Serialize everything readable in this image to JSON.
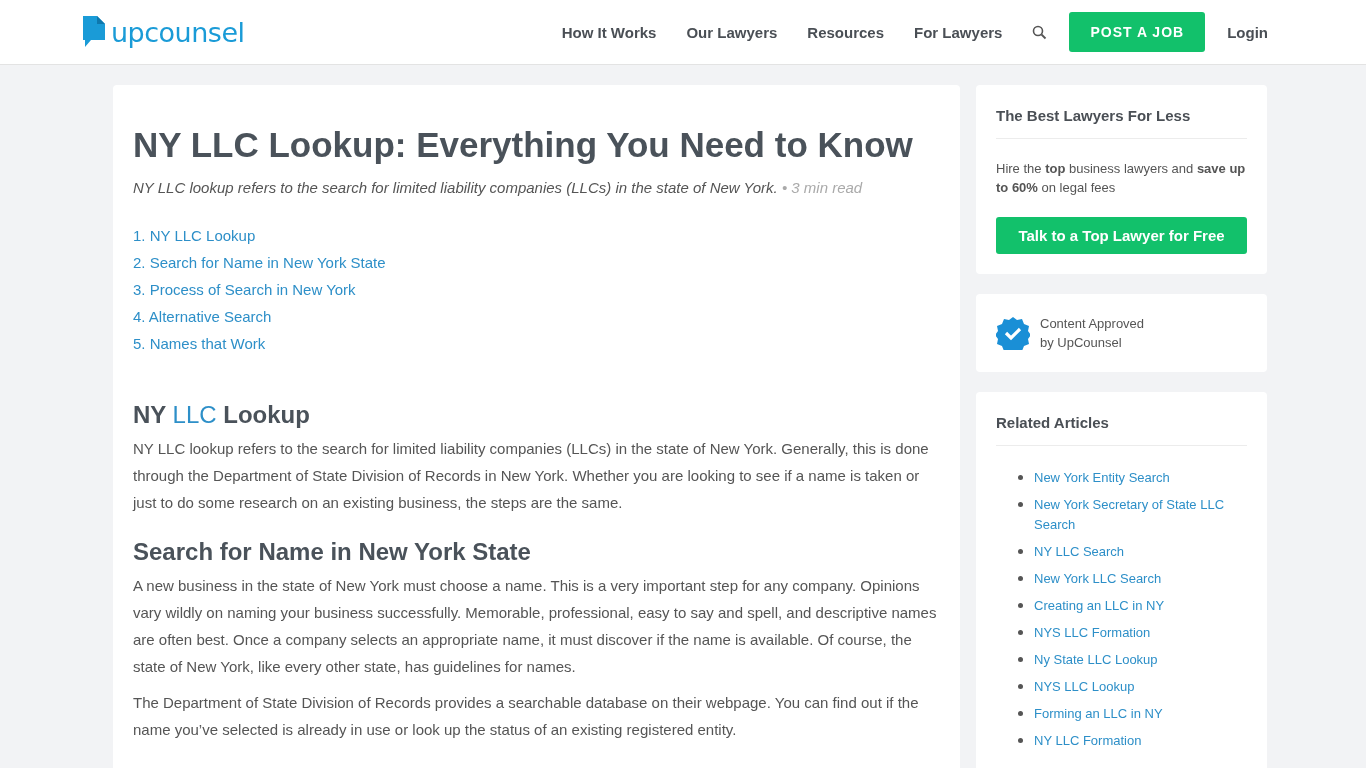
{
  "header": {
    "logo": "upcounsel",
    "nav": [
      "How It Works",
      "Our Lawyers",
      "Resources",
      "For Lawyers"
    ],
    "post_button": "POST A JOB",
    "login": "Login"
  },
  "article": {
    "title": "NY LLC Lookup: Everything You Need to Know",
    "summary": "NY LLC lookup refers to the search for limited liability companies (LLCs) in the state of New York.",
    "read_time": "• 3 min read",
    "toc": [
      {
        "number": "1.",
        "label": "NY LLC Lookup"
      },
      {
        "number": "2.",
        "label": "Search for Name in New York State"
      },
      {
        "number": "3.",
        "label": "Process of Search in New York"
      },
      {
        "number": "4.",
        "label": "Alternative Search"
      },
      {
        "number": "5.",
        "label": "Names that Work"
      }
    ],
    "sections": [
      {
        "heading": [
          {
            "text": "NY ",
            "link": false
          },
          {
            "text": "LLC",
            "link": true
          },
          {
            "text": " Lookup",
            "link": false
          }
        ],
        "paragraphs": [
          "NY LLC lookup refers to the search for limited liability companies (LLCs) in the state of New York. Generally, this is done through the Department of State Division of Records in New York. Whether you are looking to see if a name is taken or just to do some research on an existing business, the steps are the same."
        ]
      },
      {
        "heading": [
          {
            "text": "Search for Name in New York State",
            "link": false
          }
        ],
        "paragraphs": [
          "A new business in the state of New York must choose a name. This is a very important step for any company. Opinions vary wildly on naming your business successfully. Memorable, professional, easy to say and spell, and descriptive names are often best. Once a company selects an appropriate name, it must discover if the name is available. Of course, the state of New York, like every other state, has guidelines for names.",
          "The Department of State Division of Records provides a searchable database on their webpage. You can find out if the name you’ve selected is already in use or look up the status of an existing registered entity."
        ]
      }
    ]
  },
  "sidebar": {
    "promo": {
      "title": "The Best Lawyers For Less",
      "text": "Hire the **top** business lawyers and **save up to 60%** on legal fees",
      "button": "Talk to a Top Lawyer for Free"
    },
    "approval": [
      "Content Approved",
      "by UpCounsel"
    ],
    "related": {
      "title": "Related Articles",
      "items": [
        "New York Entity Search",
        "New York Secretary of State LLC Search",
        "NY LLC Search",
        "New York LLC Search",
        "Creating an LLC in NY",
        "NYS LLC Formation",
        "Ny State LLC Lookup",
        "NYS LLC Lookup",
        "Forming an LLC in NY",
        "NY LLC Formation"
      ]
    }
  }
}
